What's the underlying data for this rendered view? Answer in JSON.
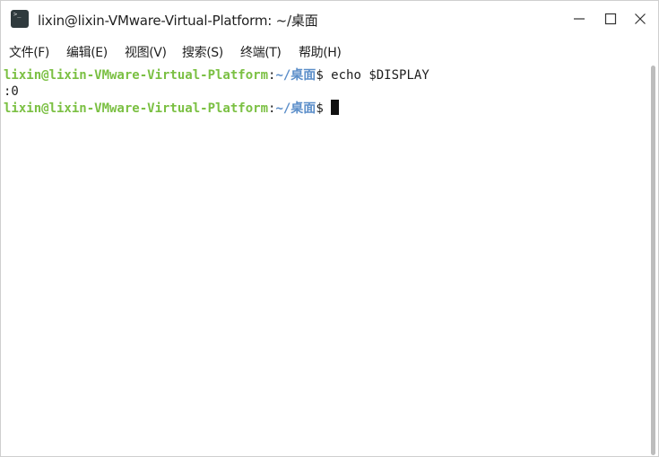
{
  "window": {
    "title": "lixin@lixin-VMware-Virtual-Platform: ~/桌面",
    "icon": "terminal-icon",
    "controls": [
      "minimize-icon",
      "maximize-icon",
      "close-icon"
    ]
  },
  "menubar": {
    "items": [
      {
        "label": "文件(F)"
      },
      {
        "label": "编辑(E)"
      },
      {
        "label": "视图(V)"
      },
      {
        "label": "搜索(S)"
      },
      {
        "label": "终端(T)"
      },
      {
        "label": "帮助(H)"
      }
    ]
  },
  "terminal": {
    "lines": [
      {
        "user": "lixin@lixin-VMware-Virtual-Platform",
        "sep": ":",
        "path": "~/桌面",
        "prompt": "$ ",
        "command": "echo $DISPLAY"
      },
      {
        "output": ":0"
      },
      {
        "user": "lixin@lixin-VMware-Virtual-Platform",
        "sep": ":",
        "path": "~/桌面",
        "prompt": "$ ",
        "command": ""
      }
    ]
  },
  "colors": {
    "user": "#7bc043",
    "path": "#5b8ec9",
    "text": "#1e1e1e",
    "background": "#ffffff"
  }
}
